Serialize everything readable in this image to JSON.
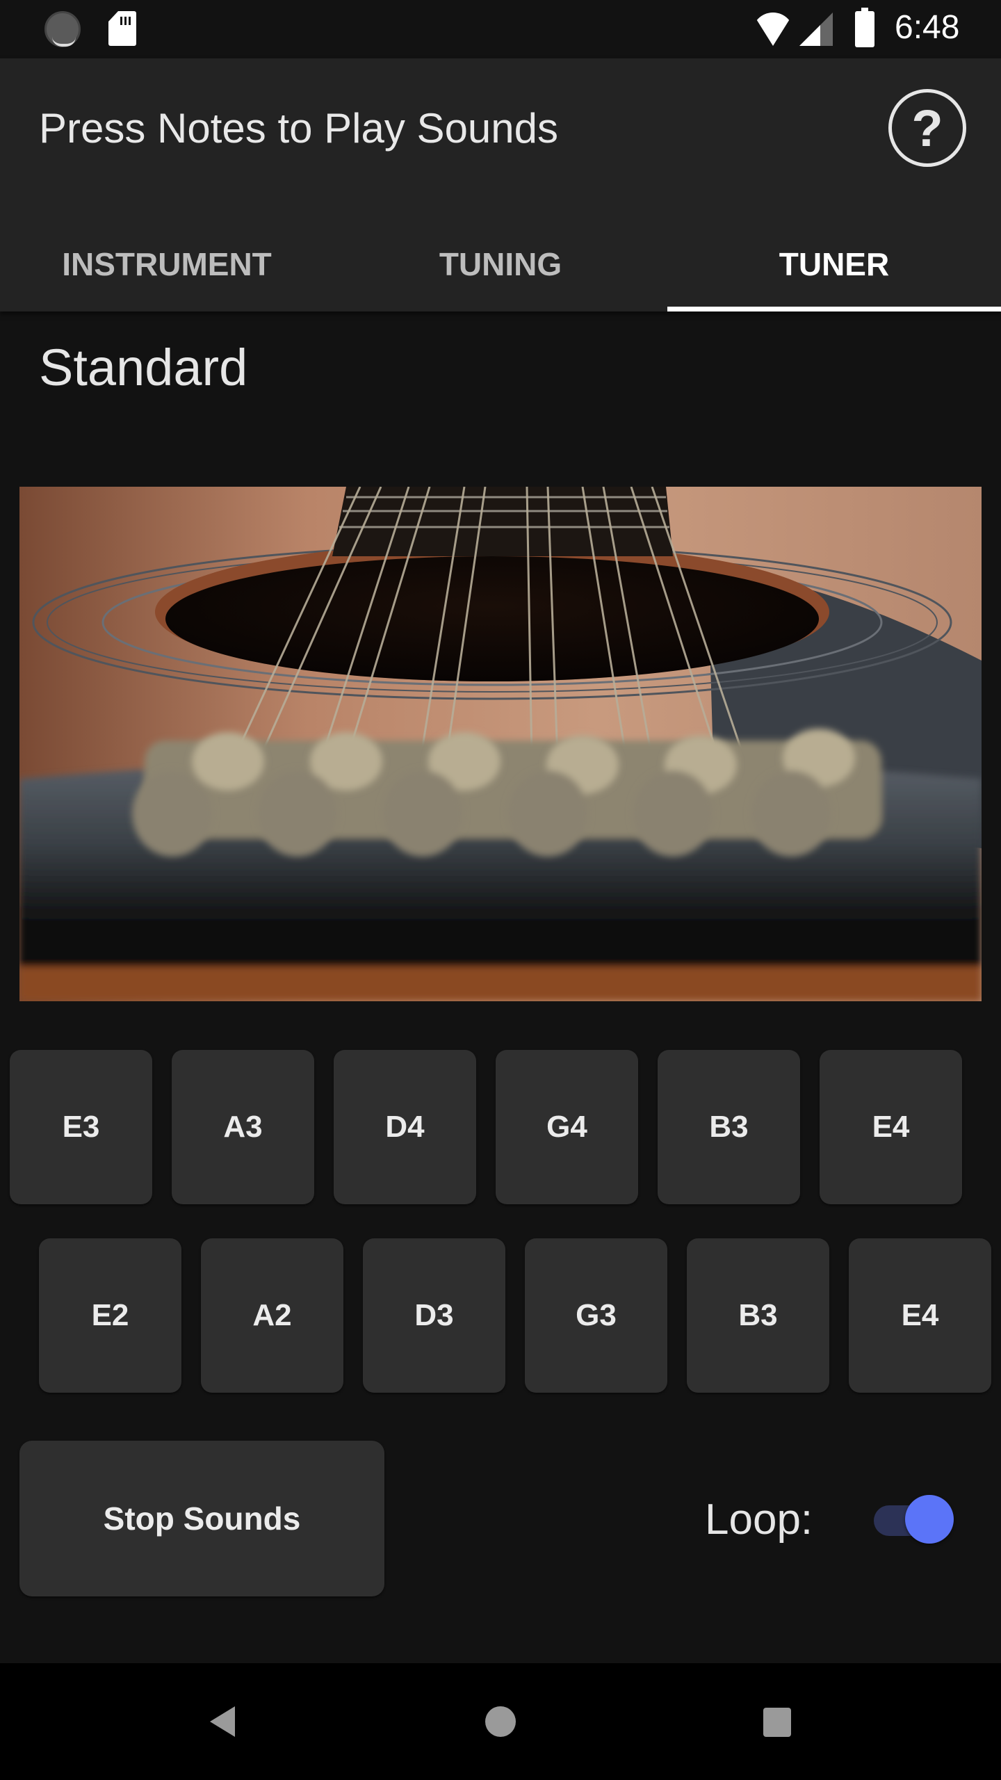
{
  "status_bar": {
    "time": "6:48",
    "icons": [
      "loading-spinner-icon",
      "sd-card-icon",
      "wifi-icon",
      "cell-signal-icon",
      "battery-icon"
    ]
  },
  "app_bar": {
    "title": "Press Notes to Play Sounds",
    "help_icon": "help-circle-icon",
    "help_glyph": "?"
  },
  "tabs": [
    {
      "label": "INSTRUMENT",
      "active": false
    },
    {
      "label": "TUNING",
      "active": false
    },
    {
      "label": "TUNER",
      "active": true
    }
  ],
  "main": {
    "tuning_name": "Standard",
    "image_description": "Close-up of acoustic 12-string guitar sound hole and bridge pins",
    "note_rows": [
      [
        "E3",
        "A3",
        "D4",
        "G4",
        "B3",
        "E4"
      ],
      [
        "E2",
        "A2",
        "D3",
        "G3",
        "B3",
        "E4"
      ]
    ],
    "stop_button": "Stop Sounds",
    "loop_label": "Loop:",
    "loop_enabled": true
  },
  "colors": {
    "background": "#121212",
    "app_bar": "#232323",
    "button": "#2f2f2f",
    "switch_thumb": "#5b74f8",
    "switch_track": "#2c3256"
  },
  "nav_bar": {
    "buttons": [
      "back-icon",
      "home-icon",
      "recents-icon"
    ]
  }
}
